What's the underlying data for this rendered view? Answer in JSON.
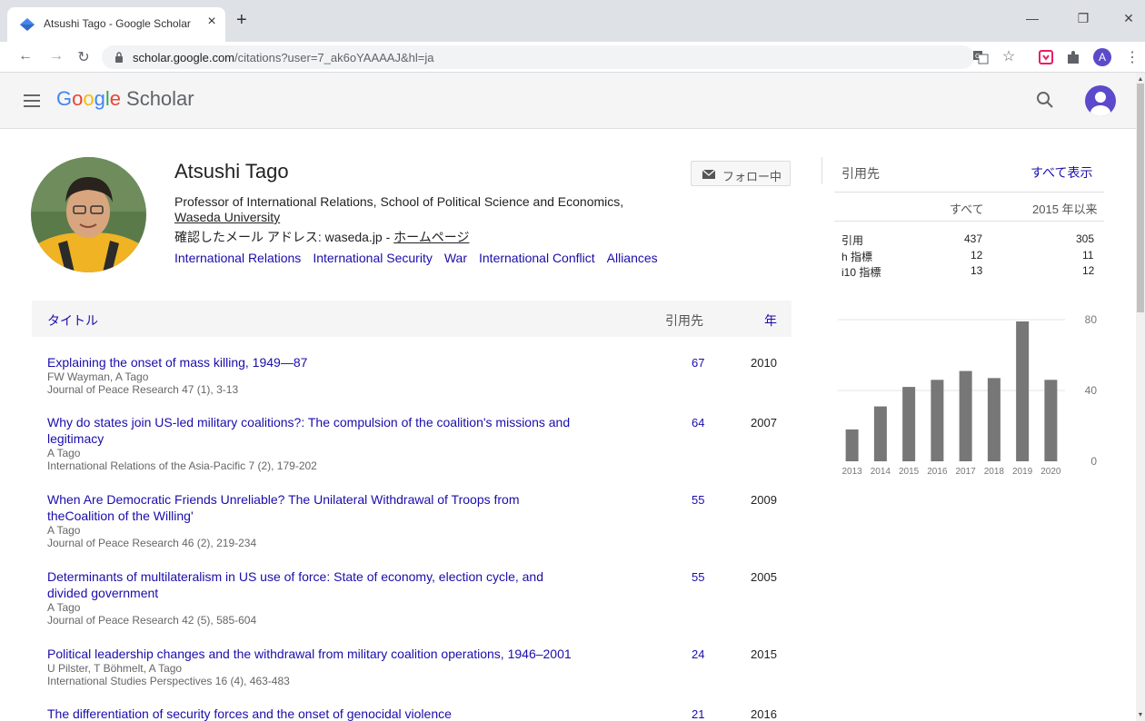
{
  "browser": {
    "tab_title": "Atsushi Tago - Google Scholar",
    "url_host": "scholar.google.com",
    "url_path": "/citations?user=7_ak6oYAAAAJ&hl=ja",
    "profile_initial": "A"
  },
  "header": {
    "logo_g1": "G",
    "logo_g2": "o",
    "logo_g3": "o",
    "logo_g4": "g",
    "logo_g5": "l",
    "logo_g6": "e",
    "logo_product": "Scholar"
  },
  "profile": {
    "name": "Atsushi Tago",
    "affiliation_line1": "Professor of International Relations, School of Political Science and Economics,",
    "affiliation_line2": "Waseda University",
    "email_prefix": "確認したメール アドレス: waseda.jp - ",
    "homepage_label": "ホームページ",
    "follow_label": "フォロー中",
    "interests": [
      "International Relations",
      "International Security",
      "War",
      "International Conflict",
      "Alliances"
    ]
  },
  "table": {
    "col_title": "タイトル",
    "col_cited": "引用先",
    "col_year": "年",
    "articles": [
      {
        "title_1": "Explaining the onset of mass killing, 1949—87",
        "title_2": "",
        "authors": "FW Wayman, A Tago",
        "venue": "Journal of Peace Research 47 (1), 3-13",
        "cites": "67",
        "year": "2010"
      },
      {
        "title_1": "Why do states join US-led military coalitions?: The compulsion of the coalition's missions and",
        "title_2": "legitimacy",
        "authors": "A Tago",
        "venue": "International Relations of the Asia-Pacific 7 (2), 179-202",
        "cites": "64",
        "year": "2007"
      },
      {
        "title_1": "When Are Democratic Friends Unreliable? The Unilateral Withdrawal of Troops from",
        "title_2": "theCoalition of the Willing'",
        "authors": "A Tago",
        "venue": "Journal of Peace Research 46 (2), 219-234",
        "cites": "55",
        "year": "2009"
      },
      {
        "title_1": "Determinants of multilateralism in US use of force: State of economy, election cycle, and",
        "title_2": "divided government",
        "authors": "A Tago",
        "venue": "Journal of Peace Research 42 (5), 585-604",
        "cites": "55",
        "year": "2005"
      },
      {
        "title_1": "Political leadership changes and the withdrawal from military coalition operations, 1946–2001",
        "title_2": "",
        "authors": "U Pilster, T Böhmelt, A Tago",
        "venue": "International Studies Perspectives 16 (4), 463-483",
        "cites": "24",
        "year": "2015"
      },
      {
        "title_1": "The differentiation of security forces and the onset of genocidal violence",
        "title_2": "",
        "authors": "",
        "venue": "",
        "cites": "21",
        "year": "2016"
      }
    ]
  },
  "stats": {
    "title": "引用先",
    "show_all": "すべて表示",
    "col_all": "すべて",
    "col_since": "2015 年以来",
    "rows": [
      {
        "label": "引用",
        "all": "437",
        "since": "305"
      },
      {
        "label": "h 指標",
        "all": "12",
        "since": "11"
      },
      {
        "label": "i10 指標",
        "all": "13",
        "since": "12"
      }
    ]
  },
  "chart_data": {
    "type": "bar",
    "categories": [
      "2013",
      "2014",
      "2015",
      "2016",
      "2017",
      "2018",
      "2019",
      "2020"
    ],
    "values": [
      18,
      31,
      42,
      46,
      51,
      47,
      79,
      46
    ],
    "ylim": [
      0,
      80
    ],
    "yticks": [
      0,
      40,
      80
    ],
    "grid": true,
    "bar_color": "#777777"
  }
}
